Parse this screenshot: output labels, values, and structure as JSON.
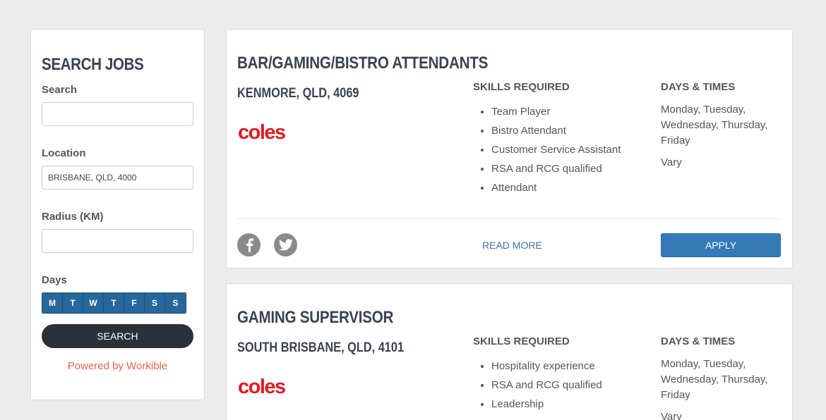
{
  "sidebar": {
    "title": "SEARCH JOBS",
    "search_label": "Search",
    "search_value": "",
    "location_label": "Location",
    "location_value": "BRISBANE, QLD, 4000",
    "radius_label": "Radius (KM)",
    "radius_value": "",
    "days_label": "Days",
    "days": [
      "M",
      "T",
      "W",
      "T",
      "F",
      "S",
      "S"
    ],
    "search_button": "SEARCH",
    "powered_by": "Powered by Workible"
  },
  "jobs": [
    {
      "title": "BAR/GAMING/BISTRO ATTENDANTS",
      "location": "KENMORE, QLD, 4069",
      "logo": "coles",
      "skills_heading": "SKILLS REQUIRED",
      "skills": [
        "Team Player",
        "Bistro Attendant",
        "Customer Service Assistant",
        "RSA and RCG qualified",
        "Attendant"
      ],
      "days_heading": "DAYS & TIMES",
      "days": "Monday, Tuesday, Wednesday, Thursday, Friday",
      "times": "Vary",
      "read_more": "READ MORE",
      "apply": "APPLY"
    },
    {
      "title": "GAMING SUPERVISOR",
      "location": "SOUTH BRISBANE, QLD, 4101",
      "logo": "coles",
      "skills_heading": "SKILLS REQUIRED",
      "skills": [
        "Hospitality experience",
        "RSA and RCG qualified",
        "Leadership"
      ],
      "days_heading": "DAYS & TIMES",
      "days": "Monday, Tuesday, Wednesday, Thursday, Friday",
      "times": "Vary"
    }
  ],
  "colors": {
    "accent": "#337ab7",
    "day_button": "#28679a",
    "powered_link": "#e8634a",
    "logo": "#e01a22"
  },
  "icons": [
    "facebook-icon",
    "twitter-icon"
  ]
}
